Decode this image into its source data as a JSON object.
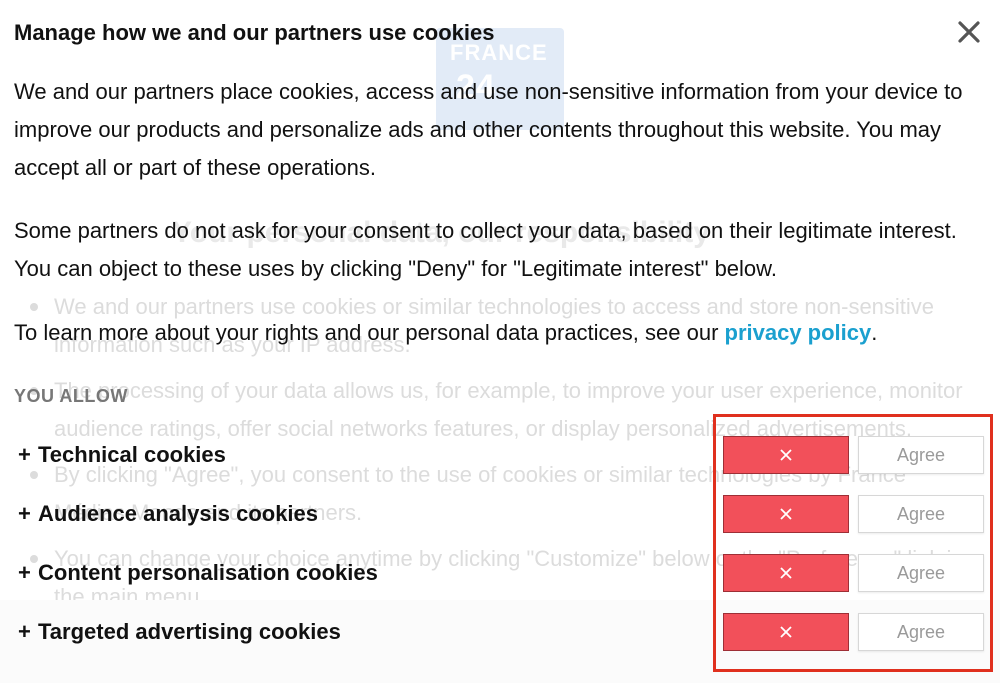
{
  "background": {
    "logo_line1": "FRANCE",
    "logo_line2": "24",
    "heading": "Your personal data, our responsibility",
    "bullets": [
      "We and our partners use cookies or similar technologies to access and store non-sensitive information such as your IP address.",
      "The processing of your data allows us, for example, to improve your user experience, monitor audience ratings, offer social networks features, or display personalized advertisements.",
      "By clicking \"Agree\", you consent to the use of cookies or similar technologies by France Médias Monde and its partners.",
      "You can change your choice anytime by clicking \"Customize\" below or the \"Preference\" link in the main menu."
    ]
  },
  "dialog": {
    "title": "Manage how we and our partners use cookies",
    "close_icon": "close-icon",
    "paragraph1": "We and our partners place cookies, access and use non-sensitive information from your device to improve our products and personalize ads and other contents throughout this website. You may accept all or part of these operations.",
    "paragraph2": "Some partners do not ask for your consent to collect your data, based on their legitimate interest. You can object to these uses by clicking \"Deny\" for \"Legitimate interest\" below.",
    "paragraph3_text": "To learn more about your rights and our personal data practices, see our ",
    "paragraph3_link": "privacy policy",
    "paragraph3_end": ".",
    "section_label": "YOU ALLOW",
    "categories": [
      {
        "plus": "+",
        "label": "Technical cookies",
        "deny_icon": "x-icon",
        "agree_label": "Agree"
      },
      {
        "plus": "+",
        "label": "Audience analysis cookies",
        "deny_icon": "x-icon",
        "agree_label": "Agree"
      },
      {
        "plus": "+",
        "label": "Content personalisation cookies",
        "deny_icon": "x-icon",
        "agree_label": "Agree"
      },
      {
        "plus": "+",
        "label": "Targeted advertising cookies",
        "deny_icon": "x-icon",
        "agree_label": "Agree"
      }
    ],
    "colors": {
      "deny": "#f2505a",
      "link": "#1ba0cf",
      "highlight": "#e0301e"
    }
  }
}
